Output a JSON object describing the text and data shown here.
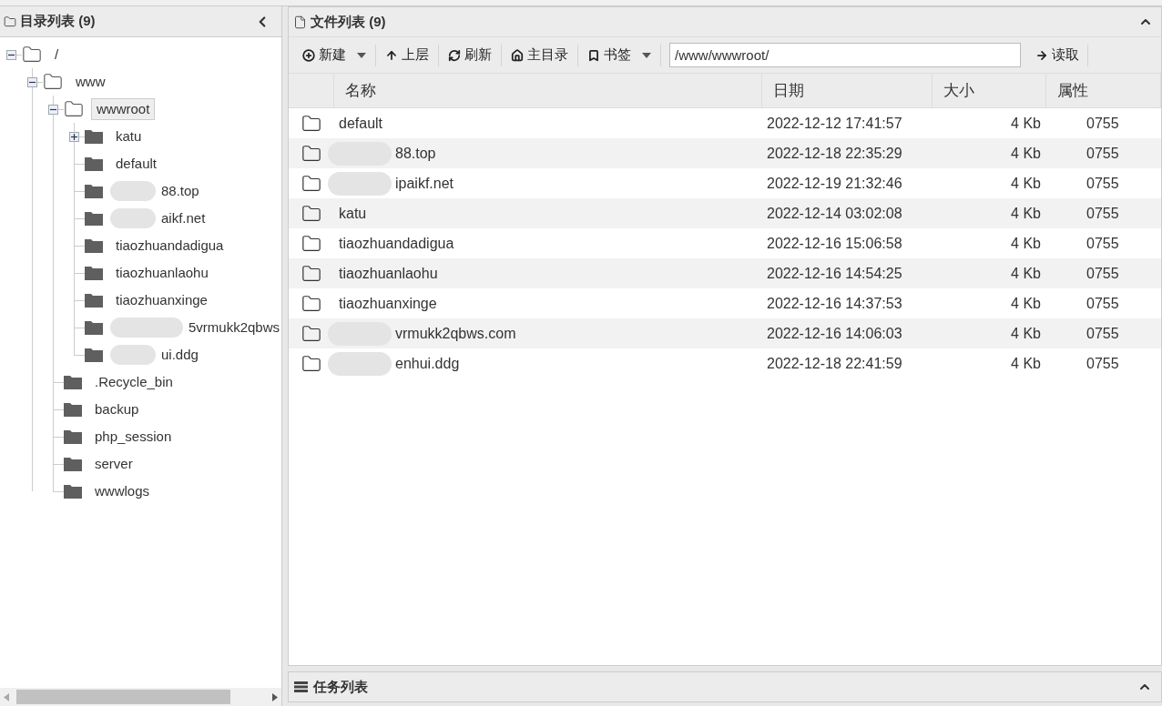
{
  "left_panel": {
    "title": "目录列表 (9)",
    "tree": [
      {
        "label": "/",
        "kind": "branch",
        "expanded": true,
        "selected": false,
        "children": [
          {
            "label": "www",
            "kind": "branch",
            "expanded": true,
            "selected": false,
            "children": [
              {
                "label": "wwwroot",
                "kind": "branch",
                "expanded": true,
                "selected": true,
                "children": [
                  {
                    "label": "katu",
                    "kind": "branch",
                    "expanded": false,
                    "selected": false
                  },
                  {
                    "label": "default",
                    "kind": "leaf",
                    "selected": false
                  },
                  {
                    "label": "88.top",
                    "kind": "leaf",
                    "selected": false,
                    "redacted": true
                  },
                  {
                    "label": "aikf.net",
                    "kind": "leaf",
                    "selected": false,
                    "redacted": true
                  },
                  {
                    "label": "tiaozhuandadigua",
                    "kind": "leaf",
                    "selected": false
                  },
                  {
                    "label": "tiaozhuanlaohu",
                    "kind": "leaf",
                    "selected": false
                  },
                  {
                    "label": "tiaozhuanxinge",
                    "kind": "leaf",
                    "selected": false
                  },
                  {
                    "label": "5vrmukk2qbws",
                    "kind": "leaf",
                    "selected": false,
                    "redacted": true
                  },
                  {
                    "label": "ui.ddg",
                    "kind": "leaf",
                    "selected": false,
                    "redacted": true
                  }
                ]
              },
              {
                "label": ".Recycle_bin",
                "kind": "leaf",
                "selected": false
              },
              {
                "label": "backup",
                "kind": "leaf",
                "selected": false
              },
              {
                "label": "php_session",
                "kind": "leaf",
                "selected": false
              },
              {
                "label": "server",
                "kind": "leaf",
                "selected": false
              },
              {
                "label": "wwwlogs",
                "kind": "leaf",
                "selected": false
              }
            ]
          }
        ]
      }
    ]
  },
  "file_panel": {
    "title": "文件列表 (9)",
    "toolbar": [
      {
        "label": "新建",
        "kind": "plus",
        "dropdown": true
      },
      {
        "label": "上层",
        "kind": "up",
        "dropdown": false
      },
      {
        "label": "刷新",
        "kind": "refresh",
        "dropdown": false
      },
      {
        "label": "主目录",
        "kind": "home",
        "dropdown": false
      },
      {
        "label": "书签",
        "kind": "bookmark",
        "dropdown": true
      }
    ],
    "path": "/www/wwwroot/",
    "read_button": "读取",
    "columns": [
      "名称",
      "日期",
      "大小",
      "属性"
    ],
    "rows": [
      {
        "name": "default",
        "date": "2022-12-12 17:41:57",
        "size": "4 Kb",
        "perm": "0755",
        "redacted": false
      },
      {
        "name": "88.top",
        "date": "2022-12-18 22:35:29",
        "size": "4 Kb",
        "perm": "0755",
        "redacted": true
      },
      {
        "name": "ipaikf.net",
        "date": "2022-12-19 21:32:46",
        "size": "4 Kb",
        "perm": "0755",
        "redacted": true
      },
      {
        "name": "katu",
        "date": "2022-12-14 03:02:08",
        "size": "4 Kb",
        "perm": "0755",
        "redacted": false
      },
      {
        "name": "tiaozhuandadigua",
        "date": "2022-12-16 15:06:58",
        "size": "4 Kb",
        "perm": "0755",
        "redacted": false
      },
      {
        "name": "tiaozhuanlaohu",
        "date": "2022-12-16 14:54:25",
        "size": "4 Kb",
        "perm": "0755",
        "redacted": false
      },
      {
        "name": "tiaozhuanxinge",
        "date": "2022-12-16 14:37:53",
        "size": "4 Kb",
        "perm": "0755",
        "redacted": false
      },
      {
        "name": "vrmukk2qbws.com",
        "date": "2022-12-16 14:06:03",
        "size": "4 Kb",
        "perm": "0755",
        "redacted": true
      },
      {
        "name": "enhui.ddg",
        "date": "2022-12-18 22:41:59",
        "size": "4 Kb",
        "perm": "0755",
        "redacted": true
      }
    ]
  },
  "task_panel": {
    "title": "任务列表"
  }
}
